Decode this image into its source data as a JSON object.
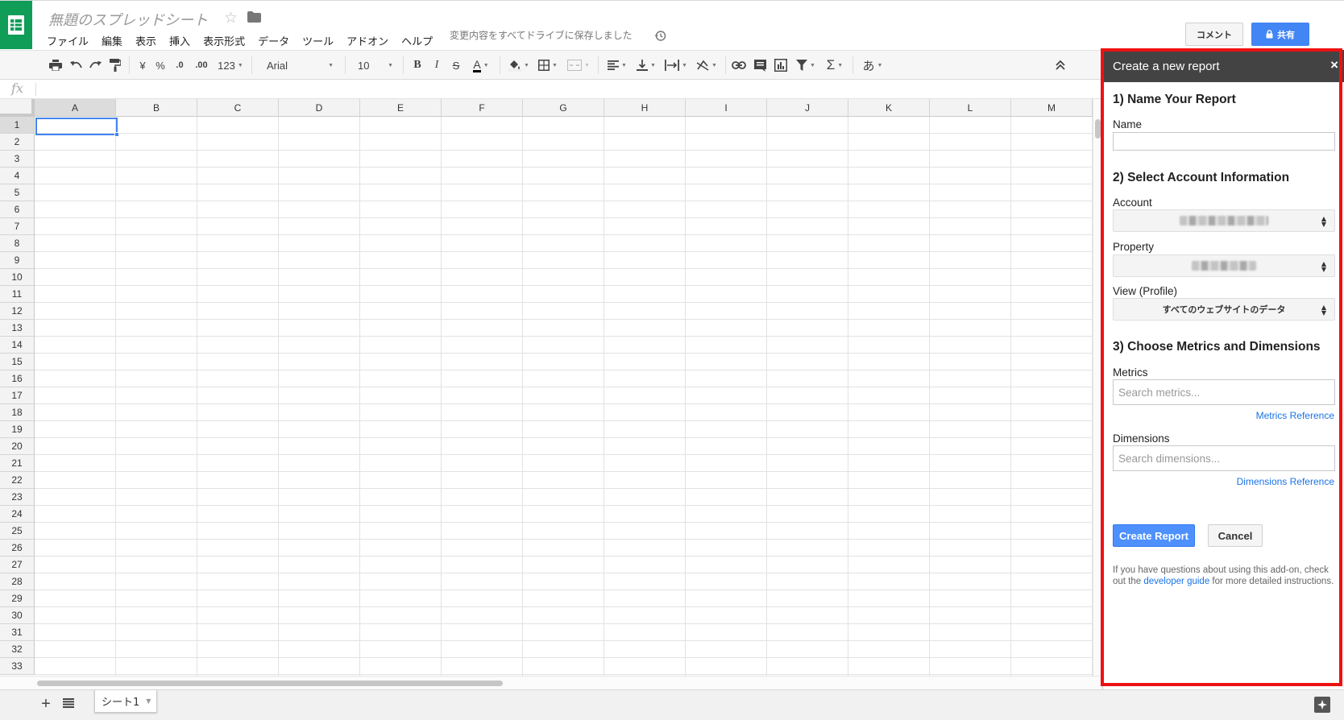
{
  "doc": {
    "title": "無題のスプレッドシート",
    "save_status": "変更内容をすべてドライブに保存しました"
  },
  "menu": [
    "ファイル",
    "編集",
    "表示",
    "挿入",
    "表示形式",
    "データ",
    "ツール",
    "アドオン",
    "ヘルプ"
  ],
  "header_buttons": {
    "comment": "コメント",
    "share": "共有"
  },
  "toolbar": {
    "currency": "¥",
    "percent": "%",
    "decrease_decimal": ".0",
    "increase_decimal": ".00",
    "more_formats": "123",
    "font": "Arial",
    "font_size": "10",
    "bold": "B",
    "italic": "I",
    "strikethrough": "S",
    "text_color": "A",
    "functions": "Σ",
    "input_tools": "あ"
  },
  "formula_bar": {
    "fx": "fx",
    "value": ""
  },
  "grid": {
    "columns": [
      "A",
      "B",
      "C",
      "D",
      "E",
      "F",
      "G",
      "H",
      "I",
      "J",
      "K",
      "L",
      "M"
    ],
    "rows": [
      "1",
      "2",
      "3",
      "4",
      "5",
      "6",
      "7",
      "8",
      "9",
      "10",
      "11",
      "12",
      "13",
      "14",
      "15",
      "16",
      "17",
      "18",
      "19",
      "20",
      "21",
      "22",
      "23",
      "24",
      "25",
      "26",
      "27",
      "28",
      "29",
      "30",
      "31",
      "32",
      "33"
    ],
    "active_cell": "A1"
  },
  "sheets": {
    "tabs": [
      "シート1"
    ],
    "active": "シート1"
  },
  "panel": {
    "title": "Create a new report",
    "close": "×",
    "section1": "1) Name Your Report",
    "name_label": "Name",
    "name_value": "",
    "section2": "2) Select Account Information",
    "account_label": "Account",
    "property_label": "Property",
    "view_label": "View (Profile)",
    "view_value": "すべてのウェブサイトのデータ",
    "section3": "3) Choose Metrics and Dimensions",
    "metrics_label": "Metrics",
    "metrics_placeholder": "Search metrics...",
    "metrics_ref": "Metrics Reference",
    "dimensions_label": "Dimensions",
    "dimensions_placeholder": "Search dimensions...",
    "dimensions_ref": "Dimensions Reference",
    "create_button": "Create Report",
    "cancel_button": "Cancel",
    "help_pre": "If you have questions about using this add-on, check out the ",
    "help_link": "developer guide",
    "help_post": " for more detailed instructions."
  },
  "colors": {
    "brand_green": "#0f9d58",
    "share_blue": "#4285f4",
    "panel_header": "#434343",
    "highlight_red": "#ee1111",
    "link_blue": "#1a73e8"
  }
}
